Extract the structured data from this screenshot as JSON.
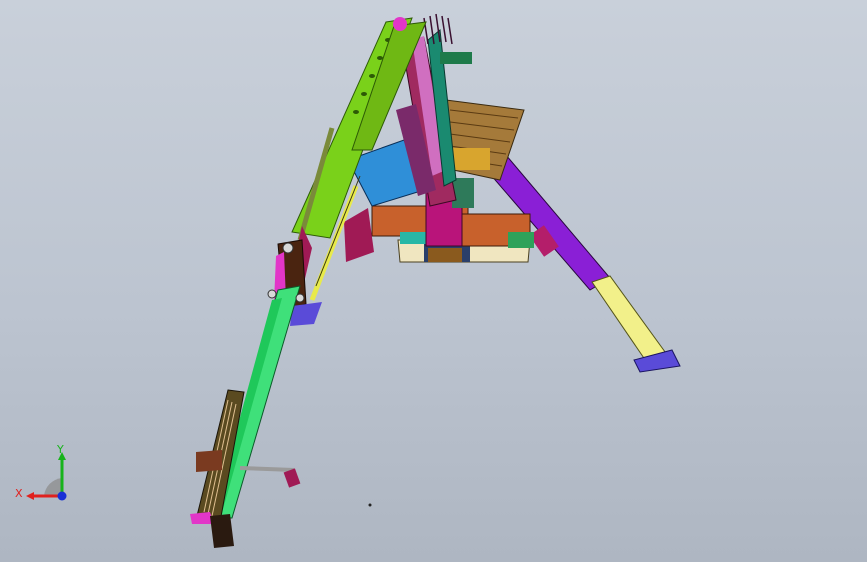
{
  "triad": {
    "x_label": "X",
    "y_label": "Y",
    "x_color": "#e0211e",
    "y_color": "#17b31b",
    "z_color": "#1830d6"
  },
  "colors": {
    "boom": "#7ad11a",
    "stick": "#3fe07a",
    "leg": "#8a1fd6",
    "leg_lower": "#f2f08a",
    "foot": "#5a4bd8",
    "magenta": "#e236c8",
    "teal": "#27b7a6",
    "brown": "#b1582b",
    "dark_red": "#9b1c44",
    "blue": "#2f8fd8"
  }
}
